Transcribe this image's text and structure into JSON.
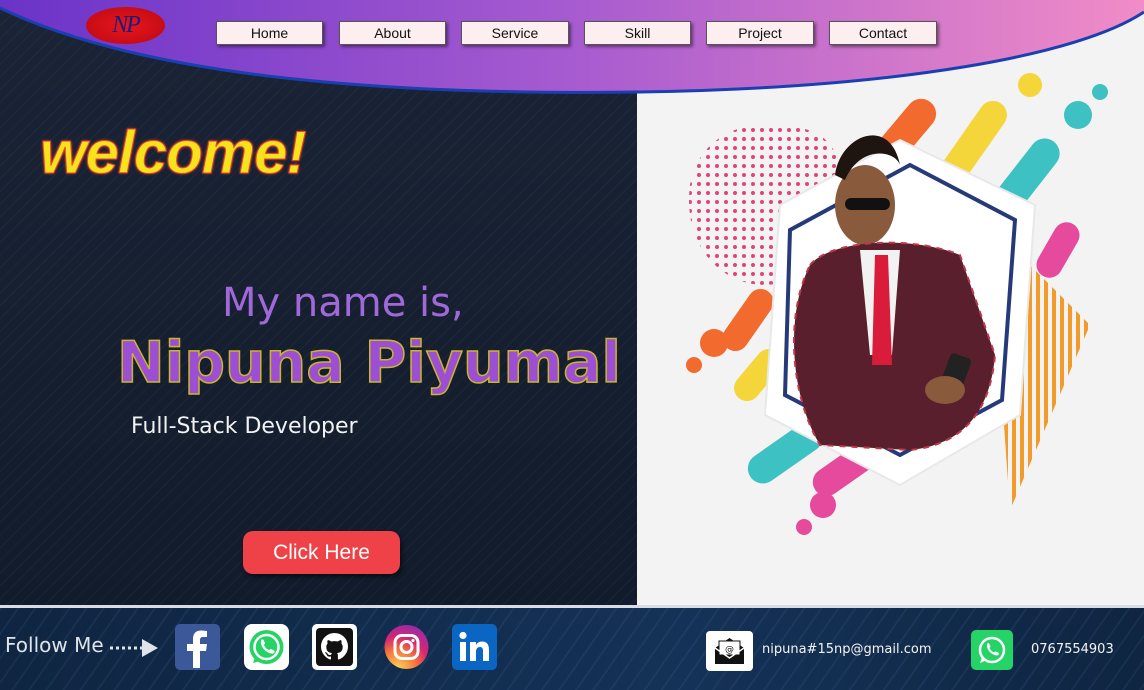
{
  "nav": {
    "logo_text": "NP",
    "items": [
      {
        "label": "Home"
      },
      {
        "label": "About"
      },
      {
        "label": "Service"
      },
      {
        "label": "Skill"
      },
      {
        "label": "Project"
      },
      {
        "label": "Contact"
      }
    ]
  },
  "hero": {
    "welcome": "welcome!",
    "intro": "My name is,",
    "name": "Nipuna Piyumal",
    "role": "Full-Stack Developer",
    "cta_label": "Click Here"
  },
  "footer": {
    "follow_label": "Follow Me",
    "social": [
      {
        "icon": "facebook-icon",
        "color": "#3b5998"
      },
      {
        "icon": "whatsapp-icon",
        "color": "#25d366"
      },
      {
        "icon": "github-icon",
        "color": "#111111"
      },
      {
        "icon": "instagram-icon",
        "color": "#e1306c"
      },
      {
        "icon": "linkedin-icon",
        "color": "#0a66c2"
      }
    ],
    "email": "nipuna#15np@gmail.com",
    "phone": "0767554903"
  },
  "colors": {
    "nav_gradient_start": "#7b3fd1",
    "nav_gradient_end": "#ee86c8",
    "welcome": "#f7e21b",
    "name": "#9c4fd3",
    "cta": "#ee4248"
  }
}
